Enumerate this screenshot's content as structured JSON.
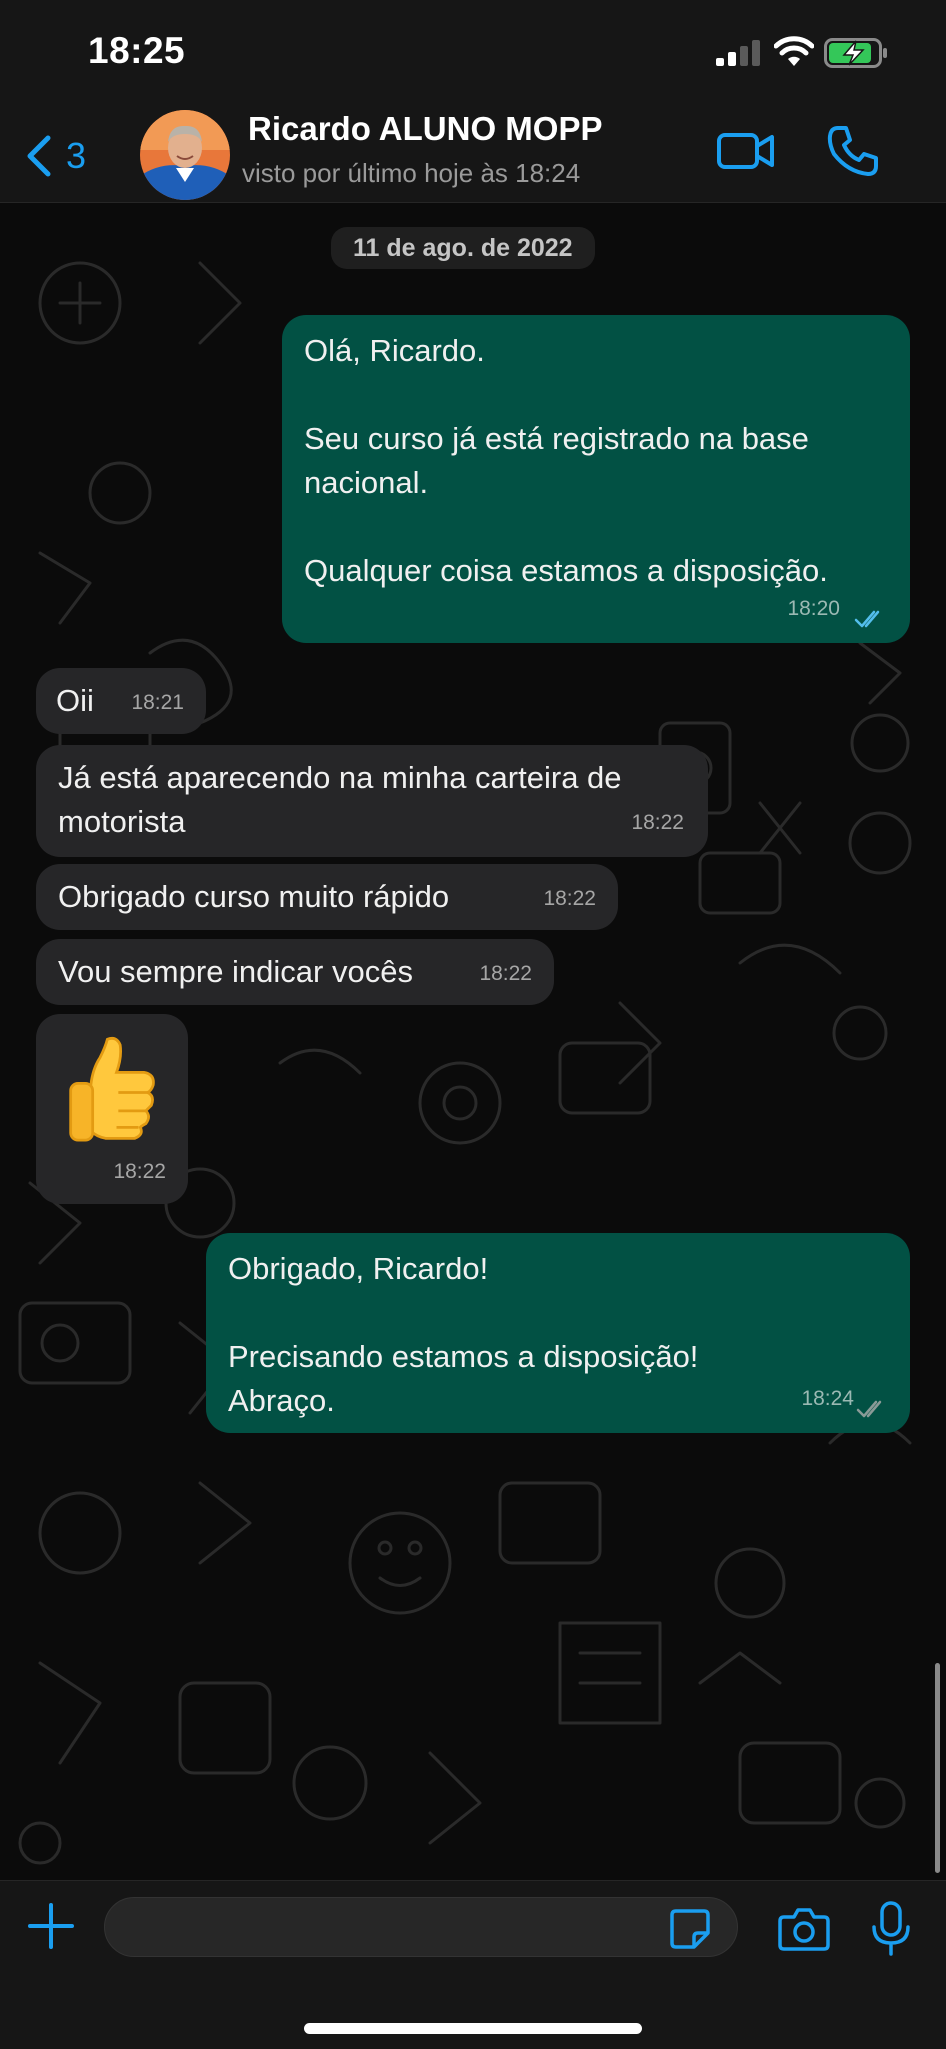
{
  "status_bar": {
    "time": "18:25"
  },
  "header": {
    "back_count": "3",
    "contact_name": "Ricardo ALUNO MOPP",
    "last_seen": "visto por último hoje às 18:24"
  },
  "chat": {
    "date_label": "11 de ago. de 2022",
    "messages": [
      {
        "direction": "outgoing",
        "lines": [
          "Olá, Ricardo.",
          "",
          "Seu curso já está registrado na base",
          "nacional.",
          "",
          "Qualquer coisa estamos a disposição."
        ],
        "time": "18:20",
        "status": "read"
      },
      {
        "direction": "incoming",
        "text": "Oii",
        "time": "18:21"
      },
      {
        "direction": "incoming",
        "lines": [
          "Já está aparecendo na minha carteira de",
          "motorista"
        ],
        "time": "18:22"
      },
      {
        "direction": "incoming",
        "text": "Obrigado curso muito rápido",
        "time": "18:22"
      },
      {
        "direction": "incoming",
        "text": "Vou sempre indicar vocês",
        "time": "18:22"
      },
      {
        "direction": "incoming",
        "emoji": "thumbs-up",
        "time": "18:22"
      },
      {
        "direction": "outgoing",
        "lines": [
          "Obrigado, Ricardo!",
          "",
          "Precisando estamos a disposição!",
          "Abraço."
        ],
        "time": "18:24",
        "status": "delivered"
      }
    ]
  },
  "input_bar": {
    "placeholder": ""
  },
  "colors": {
    "accent": "#1a9ef0",
    "outgoing_bubble": "#025144",
    "incoming_bubble": "#262628",
    "read_ticks": "#53bdeb",
    "background": "#0b0b0b"
  },
  "icons": [
    "chevron-left-icon",
    "video-call-icon",
    "phone-icon",
    "plus-icon",
    "sticker-icon",
    "camera-icon",
    "microphone-icon",
    "read-receipt-icon",
    "thumbs-up-emoji"
  ]
}
